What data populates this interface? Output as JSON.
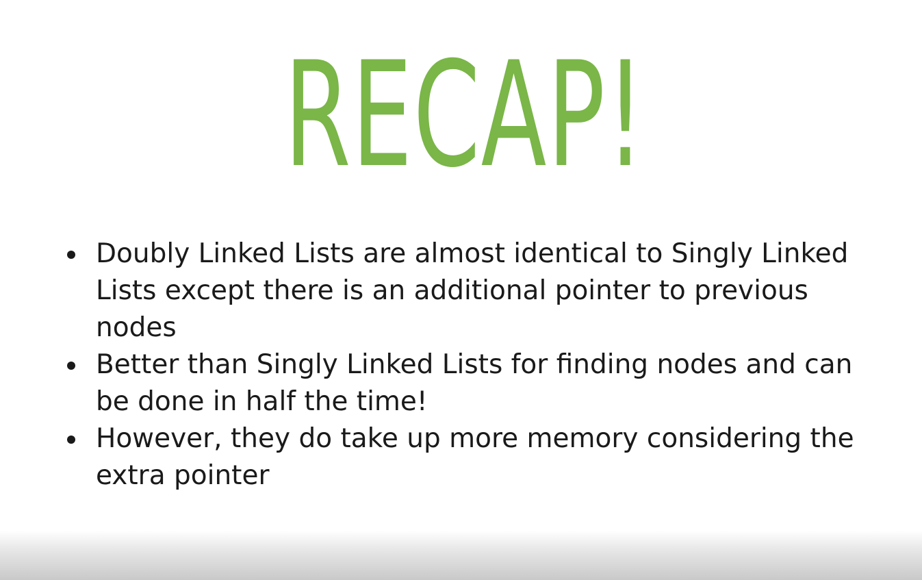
{
  "slide": {
    "title": "RECAP!",
    "title_color": "#7ab648",
    "text_color": "#1a1a1a",
    "bullets": [
      {
        "text": "Doubly Linked Lists are almost identical to Singly Linked Lists except there is an additional pointer to previous nodes"
      },
      {
        "text": "Better than Singly Linked Lists for finding nodes and can be done in half the time!"
      },
      {
        "text": "However, they do take up more memory considering the extra pointer"
      }
    ]
  }
}
